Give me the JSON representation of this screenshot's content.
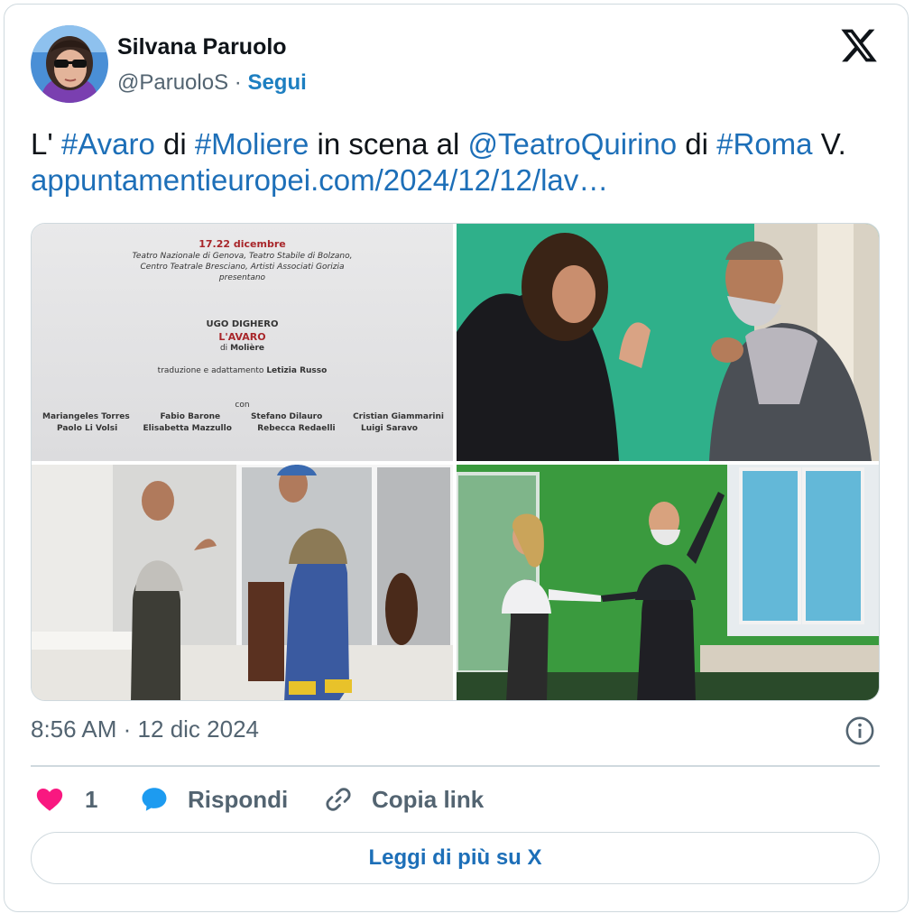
{
  "author": {
    "name": "Silvana Paruolo",
    "handle": "@ParuoloS",
    "separator": "·",
    "follow_label": "Segui"
  },
  "tweet": {
    "segments": [
      {
        "text": "L' ",
        "link": false
      },
      {
        "text": "#Avaro",
        "link": true
      },
      {
        "text": " di ",
        "link": false
      },
      {
        "text": "#Moliere",
        "link": true
      },
      {
        "text": " in scena al ",
        "link": false
      },
      {
        "text": "@TeatroQuirino",
        "link": true
      },
      {
        "text": " di ",
        "link": false
      },
      {
        "text": "#Roma",
        "link": true
      },
      {
        "text": " V. ",
        "link": false
      },
      {
        "text": "appuntamentieuropei.com/2024/12/12/lav…",
        "link": true
      }
    ]
  },
  "poster": {
    "dates": "17.22 dicembre",
    "producers_1": "Teatro Nazionale di Genova, Teatro Stabile di Bolzano,",
    "producers_2": "Centro Teatrale Bresciano, Artisti Associati Gorizia",
    "presents": "presentano",
    "lead": "UGO DIGHERO",
    "title": "L'AVARO",
    "author_prefix": "di",
    "author": "Molière",
    "translation_prefix": "traduzione e adattamento",
    "translator": "Letizia Russo",
    "with": "con",
    "cast_row_1": [
      "Mariangeles Torres",
      "Fabio Barone",
      "Stefano Dilauro",
      "Cristian Giammarini"
    ],
    "cast_row_2": [
      "Paolo Li Volsi",
      "Elisabetta Mazzullo",
      "Rebecca Redaelli",
      "Luigi Saravo"
    ]
  },
  "meta": {
    "time": "8:56 AM",
    "separator": "·",
    "date": "12 dic 2024"
  },
  "actions": {
    "like_count": "1",
    "reply_label": "Rispondi",
    "copy_label": "Copia link"
  },
  "read_more_label": "Leggi di più su X",
  "icons": {
    "logo": "x-logo-icon",
    "info": "info-icon",
    "like": "heart-icon",
    "reply": "reply-bubble-icon",
    "copy": "link-icon"
  },
  "colors": {
    "link": "#1d6fb8",
    "heart": "#f91880",
    "reply": "#1d9bf0",
    "muted": "#536471",
    "border": "#cfd9de"
  }
}
